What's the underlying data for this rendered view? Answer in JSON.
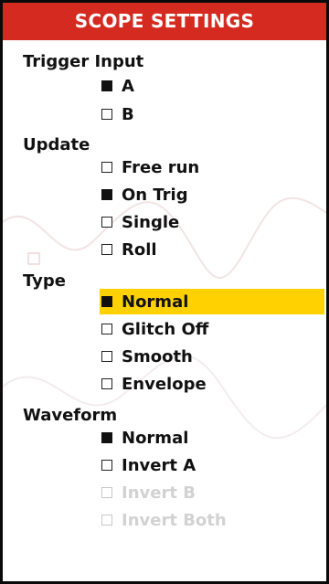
{
  "title": "SCOPE SETTINGS",
  "colors": {
    "title_bar": "#d42a20",
    "highlight": "#ffd100",
    "text": "#111111",
    "disabled_text": "#d2d2d2"
  },
  "sections": {
    "trigger_input": {
      "label": "Trigger Input",
      "options": [
        {
          "label": "A",
          "checked": true,
          "enabled": true
        },
        {
          "label": "B",
          "checked": false,
          "enabled": true
        }
      ]
    },
    "update": {
      "label": "Update",
      "options": [
        {
          "label": "Free run",
          "checked": false,
          "enabled": true
        },
        {
          "label": "On Trig",
          "checked": true,
          "enabled": true
        },
        {
          "label": "Single",
          "checked": false,
          "enabled": true
        },
        {
          "label": "Roll",
          "checked": false,
          "enabled": true
        }
      ]
    },
    "type": {
      "label": "Type",
      "options": [
        {
          "label": "Normal",
          "checked": true,
          "enabled": true,
          "highlighted": true
        },
        {
          "label": "Glitch Off",
          "checked": false,
          "enabled": true
        },
        {
          "label": "Smooth",
          "checked": false,
          "enabled": true
        },
        {
          "label": "Envelope",
          "checked": false,
          "enabled": true
        }
      ]
    },
    "waveform": {
      "label": "Waveform",
      "options": [
        {
          "label": "Normal",
          "checked": true,
          "enabled": true
        },
        {
          "label": "Invert A",
          "checked": false,
          "enabled": true
        },
        {
          "label": "Invert B",
          "checked": false,
          "enabled": false
        },
        {
          "label": "Invert Both",
          "checked": false,
          "enabled": false
        }
      ]
    }
  }
}
